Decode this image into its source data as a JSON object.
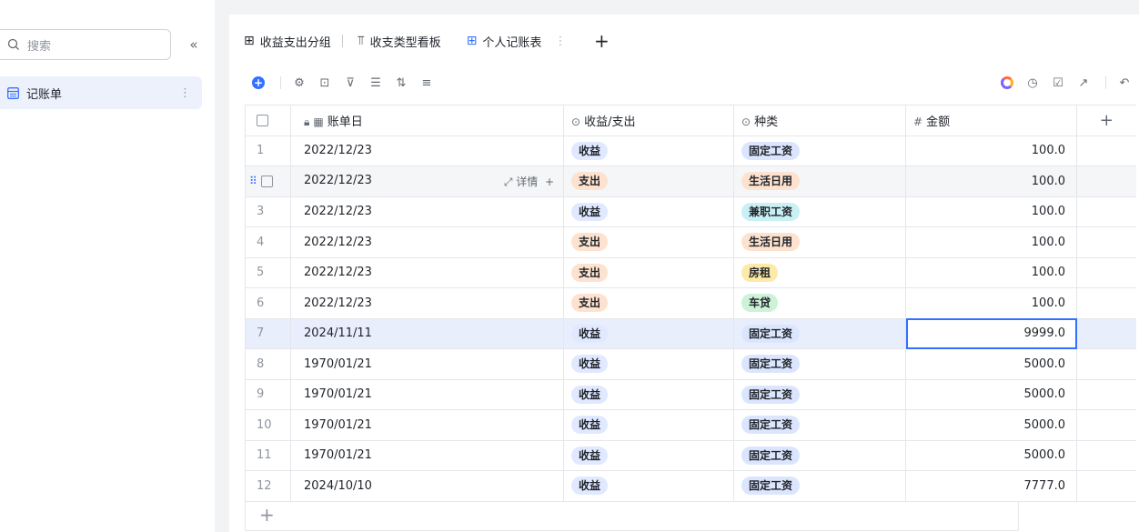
{
  "sidebar": {
    "search_placeholder": "搜索",
    "collapse_icon": "«",
    "items": [
      {
        "label": "记账单",
        "icon": "table-icon"
      }
    ]
  },
  "tabs": [
    {
      "label": "收益支出分组",
      "icon": "table-icon"
    },
    {
      "label": "收支类型看板",
      "icon": "kanban-icon"
    },
    {
      "label": "个人记账表",
      "icon": "table-icon",
      "active": true
    }
  ],
  "toolbar": {
    "left_icons": [
      "add-record-icon",
      "settings-icon",
      "field-config-icon",
      "filter-icon",
      "group-icon",
      "sort-icon",
      "row-height-icon"
    ],
    "right_icons": [
      "ai-icon",
      "history-icon",
      "checklist-icon",
      "share-icon",
      "undo-icon"
    ]
  },
  "columns": {
    "date": "账单日",
    "type": "收益/支出",
    "kind": "种类",
    "amount": "金额"
  },
  "row_tools": {
    "detail": "详情",
    "add": "+"
  },
  "rows": [
    {
      "idx": "1",
      "date": "2022/12/23",
      "type": "收益",
      "kind": "固定工资",
      "amount": "100.0"
    },
    {
      "idx": "2",
      "date": "2022/12/23",
      "type": "支出",
      "kind": "生活日用",
      "amount": "100.0"
    },
    {
      "idx": "3",
      "date": "2022/12/23",
      "type": "收益",
      "kind": "兼职工资",
      "amount": "100.0"
    },
    {
      "idx": "4",
      "date": "2022/12/23",
      "type": "支出",
      "kind": "生活日用",
      "amount": "100.0"
    },
    {
      "idx": "5",
      "date": "2022/12/23",
      "type": "支出",
      "kind": "房租",
      "amount": "100.0"
    },
    {
      "idx": "6",
      "date": "2022/12/23",
      "type": "支出",
      "kind": "车贷",
      "amount": "100.0"
    },
    {
      "idx": "7",
      "date": "2024/11/11",
      "type": "收益",
      "kind": "固定工资",
      "amount": "9999.0"
    },
    {
      "idx": "8",
      "date": "1970/01/21",
      "type": "收益",
      "kind": "固定工资",
      "amount": "5000.0"
    },
    {
      "idx": "9",
      "date": "1970/01/21",
      "type": "收益",
      "kind": "固定工资",
      "amount": "5000.0"
    },
    {
      "idx": "10",
      "date": "1970/01/21",
      "type": "收益",
      "kind": "固定工资",
      "amount": "5000.0"
    },
    {
      "idx": "11",
      "date": "1970/01/21",
      "type": "收益",
      "kind": "固定工资",
      "amount": "5000.0"
    },
    {
      "idx": "12",
      "date": "2024/10/10",
      "type": "收益",
      "kind": "固定工资",
      "amount": "7777.0"
    }
  ],
  "colors": {
    "accent": "#3370ff",
    "income_tag": "#e0e9ff",
    "expense_tag": "#fde2cf"
  }
}
